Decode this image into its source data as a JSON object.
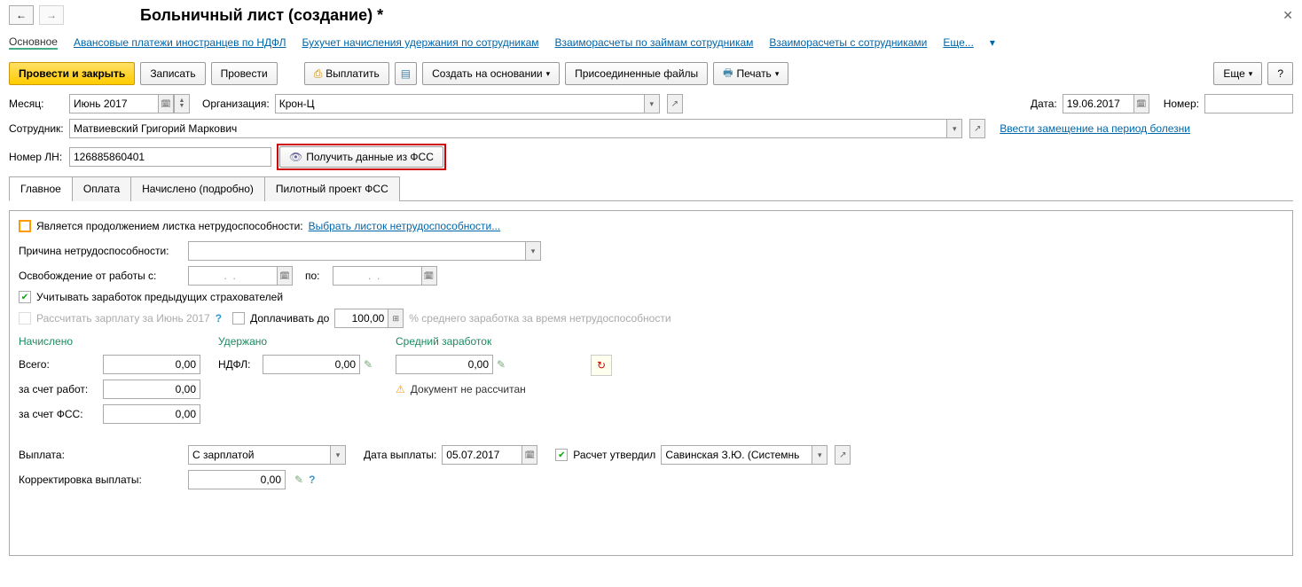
{
  "nav": {
    "back": "←",
    "fwd": "→"
  },
  "title": "Больничный лист (создание) *",
  "linkbar": {
    "cur": "Основное",
    "l1": "Авансовые платежи иностранцев по НДФЛ",
    "l2": "Бухучет начисления удержания по сотрудникам",
    "l3": "Взаиморасчеты по займам сотрудникам",
    "l4": "Взаиморасчеты с сотрудниками",
    "more": "Еще..."
  },
  "tb": {
    "main": "Провести и закрыть",
    "save": "Записать",
    "post": "Провести",
    "pay": "Выплатить",
    "create": "Создать на основании",
    "files": "Присоединенные файлы",
    "print": "Печать",
    "more": "Еще",
    "help": "?"
  },
  "month": {
    "lbl": "Месяц:",
    "val": "Июнь 2017"
  },
  "org": {
    "lbl": "Организация:",
    "val": "Крон-Ц"
  },
  "date": {
    "lbl": "Дата:",
    "val": "19.06.2017"
  },
  "num": {
    "lbl": "Номер:",
    "val": ""
  },
  "emp": {
    "lbl": "Сотрудник:",
    "val": "Матвиевский Григорий Маркович"
  },
  "subst": "Ввести замещение на период болезни",
  "ln": {
    "lbl": "Номер ЛН:",
    "val": "126885860401"
  },
  "fss_btn": "Получить данные из ФСС",
  "tabs": {
    "t1": "Главное",
    "t2": "Оплата",
    "t3": "Начислено (подробно)",
    "t4": "Пилотный проект ФСС"
  },
  "cont": {
    "lbl": "Является продолжением листка нетрудоспособности:",
    "link": "Выбрать листок нетрудоспособности..."
  },
  "reason": {
    "lbl": "Причина нетрудоспособности:",
    "val": ""
  },
  "release": {
    "lbl": "Освобождение от работы с:",
    "from": "  .  .    ",
    "to_lbl": "по:",
    "to": "  .  .    "
  },
  "prev": "Учитывать заработок предыдущих страхователей",
  "calc": "Рассчитать зарплату за Июнь 2017",
  "addpay": {
    "lbl": "Доплачивать до",
    "val": "100,00",
    "suf": "% среднего заработка за время нетрудоспособности"
  },
  "accr": {
    "title": "Начислено",
    "total_l": "Всего:",
    "total": "0,00",
    "emp_l": "за счет работ:",
    "emp": "0,00",
    "fss_l": "за счет ФСС:",
    "fss": "0,00"
  },
  "ded": {
    "title": "Удержано",
    "ndfl_l": "НДФЛ:",
    "ndfl": "0,00"
  },
  "avg": {
    "title": "Средний заработок",
    "val": "0,00"
  },
  "warn": "Документ не рассчитан",
  "payout": {
    "lbl": "Выплата:",
    "val": "С зарплатой",
    "date_l": "Дата выплаты:",
    "date": "05.07.2017",
    "appr": "Расчет утвердил",
    "who": "Савинская З.Ю. (Системнь"
  },
  "corr": {
    "lbl": "Корректировка выплаты:",
    "val": "0,00"
  }
}
